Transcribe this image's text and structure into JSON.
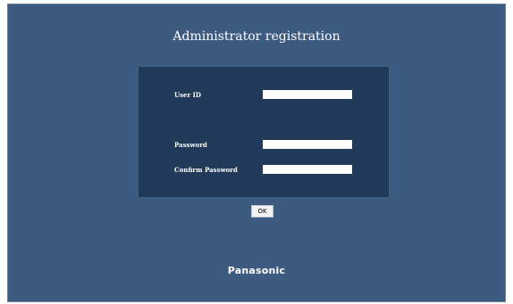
{
  "page": {
    "title": "Administrator registration"
  },
  "form": {
    "user_id_label": "User ID",
    "user_id_value": "",
    "password_label": "Password",
    "password_value": "",
    "confirm_password_label": "Confirm Password",
    "confirm_password_value": ""
  },
  "actions": {
    "ok_label": "OK"
  },
  "brand": {
    "logo_text": "Panasonic"
  },
  "colors": {
    "background": "#3d5a80",
    "panel": "#213a5a",
    "text": "#ffffff"
  }
}
